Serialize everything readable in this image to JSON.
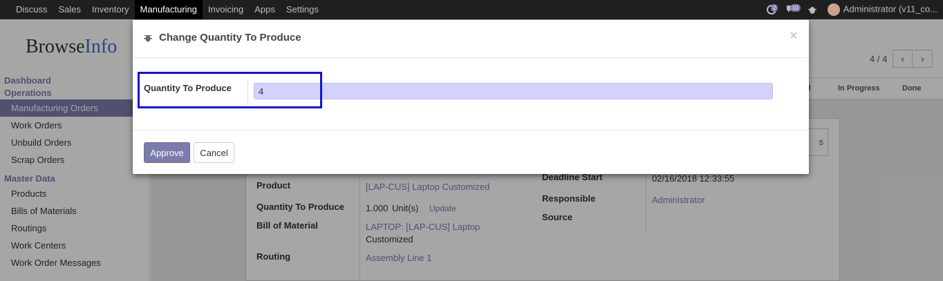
{
  "navbar": {
    "menu": [
      "Discuss",
      "Sales",
      "Inventory",
      "Manufacturing",
      "Invoicing",
      "Apps",
      "Settings"
    ],
    "active": "Manufacturing",
    "messages_badge": "2",
    "chat_badge": "10",
    "user": "Administrator (v11_co..."
  },
  "logo": {
    "part1": "Browse",
    "part2": "Info"
  },
  "sidebar": {
    "sections": [
      {
        "header": "Dashboard",
        "items": []
      },
      {
        "header": "Operations",
        "items": [
          "Manufacturing Orders",
          "Work Orders",
          "Unbuild Orders",
          "Scrap Orders"
        ]
      },
      {
        "header": "Master Data",
        "items": [
          "Products",
          "Bills of Materials",
          "Routings",
          "Work Centers",
          "Work Order Messages"
        ]
      }
    ],
    "active_item": "Manufacturing Orders"
  },
  "pager": {
    "text": "4 / 4"
  },
  "statusbar": {
    "states": [
      "ed",
      "In Progress",
      "Done"
    ]
  },
  "form": {
    "button_partial": "s",
    "product_label": "Product",
    "product_value": "[LAP-CUS] Laptop Customized",
    "qty_label": "Quantity To Produce",
    "qty_value": "1.000",
    "qty_unit": "Unit(s)",
    "update_link": "Update",
    "bom_label": "Bill of Material",
    "bom_value_line1": "LAPTOP: [LAP-CUS] Laptop",
    "bom_value_line2": "Customized",
    "routing_label": "Routing",
    "routing_value": "Assembly Line 1",
    "deadline_label": "Deadline Start",
    "deadline_value": "02/16/2018 12:33:55",
    "responsible_label": "Responsible",
    "responsible_value": "Administrator",
    "source_label": "Source"
  },
  "modal": {
    "title": "Change Quantity To Produce",
    "close": "×",
    "field_label": "Quantity To Produce",
    "field_value": "4",
    "approve_label": "Approve",
    "cancel_label": "Cancel"
  },
  "colors": {
    "accent": "#7c7bad",
    "highlight_box": "#1111dd",
    "input_bg": "#d2d2ff"
  }
}
